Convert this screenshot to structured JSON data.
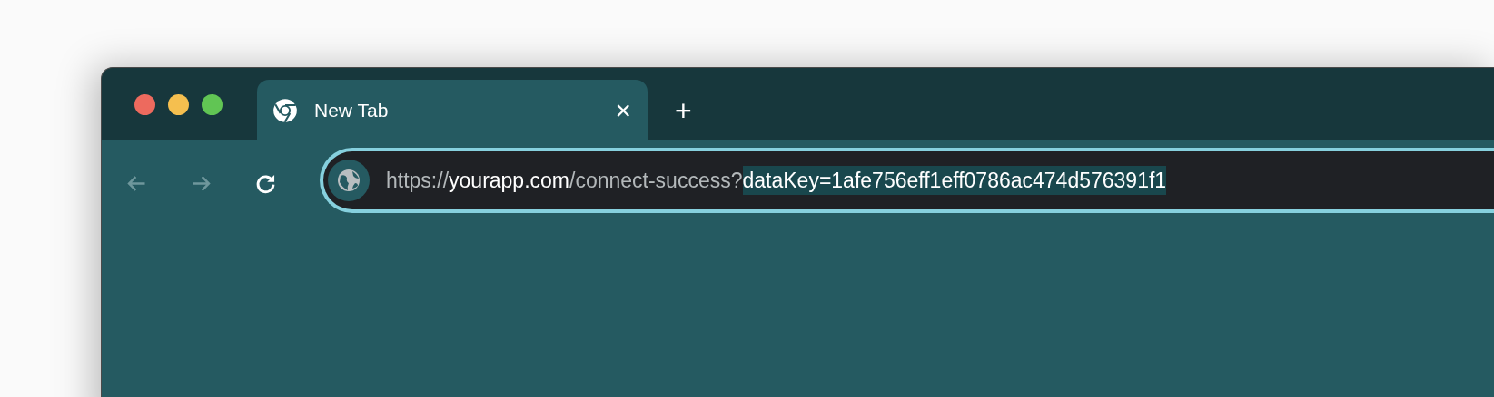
{
  "window": {
    "controls": [
      {
        "kind": "close"
      },
      {
        "kind": "minimize"
      },
      {
        "kind": "zoom"
      }
    ]
  },
  "tabs": [
    {
      "label": "New Tab",
      "selected": true,
      "close": "×"
    }
  ],
  "new_tab_button": "+",
  "toolbar": {
    "buttons": [
      {
        "kind": "back",
        "disabled": true
      },
      {
        "kind": "forward",
        "disabled": true
      },
      {
        "kind": "reload",
        "disabled": false
      }
    ]
  },
  "address_bar": {
    "focused": true,
    "segments": [
      {
        "text": "https://",
        "emphasized": false,
        "selected": false
      },
      {
        "text": "yourapp.com",
        "emphasized": true,
        "selected": false
      },
      {
        "text": "/connect-success?",
        "emphasized": false,
        "selected": false
      },
      {
        "text": "dataKey=1afe756eff1eff0786ac474d576391f1",
        "emphasized": true,
        "selected": true
      }
    ]
  }
}
